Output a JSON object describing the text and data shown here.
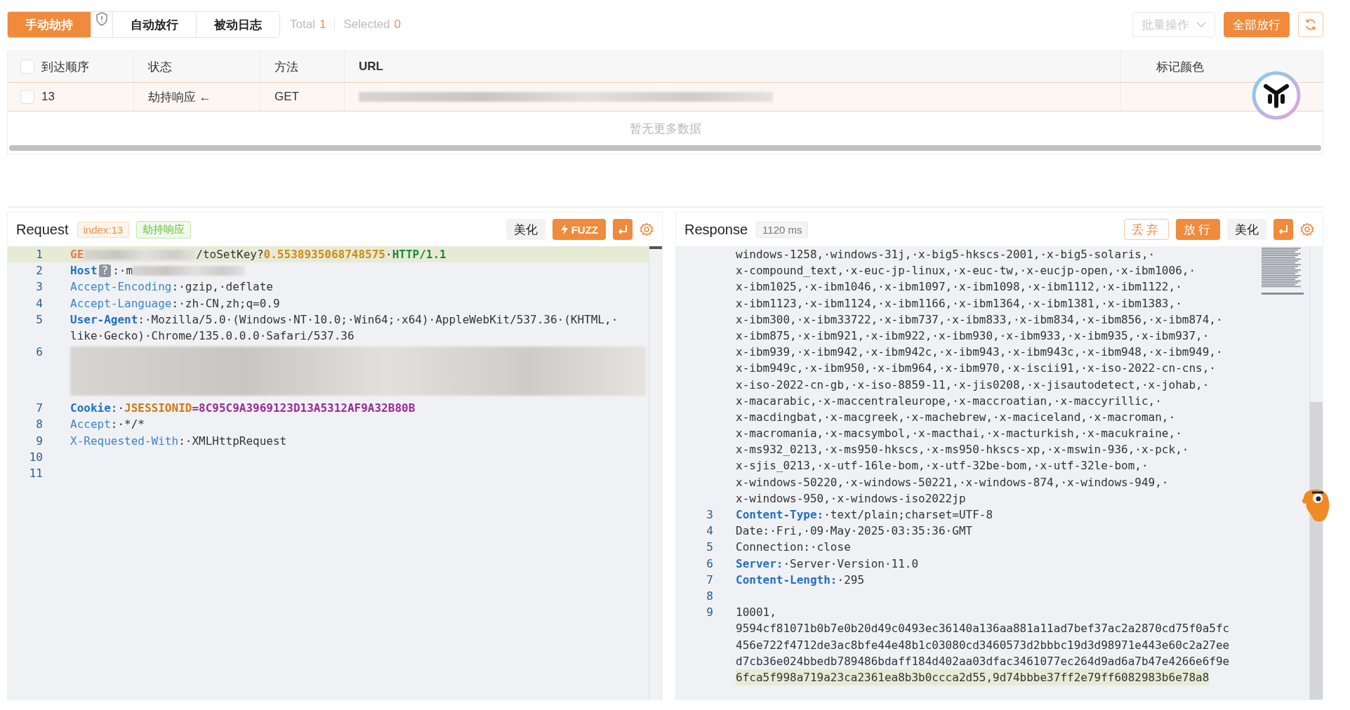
{
  "toolbar": {
    "tabs": [
      {
        "label": "手动劫持",
        "selected": true
      },
      {
        "label": "自动放行",
        "selected": false
      },
      {
        "label": "被动日志",
        "selected": false
      }
    ],
    "stats": [
      {
        "label": "Total",
        "value": "1"
      },
      {
        "label": "Selected",
        "value": "0"
      }
    ],
    "actions": [
      {
        "kind": "dropdown",
        "label": "批量操作",
        "disabled": true
      },
      {
        "kind": "primary",
        "label": "全部放行",
        "disabled": false
      }
    ]
  },
  "table": {
    "all_checked": false,
    "columns": [
      {
        "label": "到达顺序"
      },
      {
        "label": "状态"
      },
      {
        "label": "方法"
      },
      {
        "label": "URL"
      },
      {
        "label": "标记颜色"
      }
    ],
    "rows": [
      {
        "selected": true,
        "checked": false,
        "order": "13",
        "status": "劫持响应",
        "status_icon": "←",
        "method": "GET",
        "url_redacted": true
      }
    ],
    "empty_text": "暂无更多数据"
  },
  "request": {
    "title": "Request",
    "tags": [
      {
        "kind": "warning",
        "text": "index:13"
      },
      {
        "kind": "success",
        "text": "劫持响应"
      }
    ],
    "buttons": [
      {
        "kind": "plain",
        "label": "美化"
      },
      {
        "kind": "fuzz",
        "label": "FUZZ"
      }
    ],
    "lines": [
      {
        "number": "1",
        "highlighted": true,
        "segments": [
          {
            "kind": "method",
            "text": "GE"
          },
          {
            "kind": "redacted"
          },
          {
            "kind": "plain",
            "text": "/toSetKey?"
          },
          {
            "kind": "number",
            "text": "0.5538935068748575"
          },
          {
            "kind": "plain",
            "text": "·"
          },
          {
            "kind": "version",
            "text": "HTTP/1.1"
          }
        ]
      },
      {
        "number": "2",
        "highlighted": false,
        "segments": [
          {
            "kind": "keybold",
            "text": "Host"
          },
          {
            "kind": "hint",
            "text": "?"
          },
          {
            "kind": "plain",
            "text": ":·m"
          },
          {
            "kind": "redacted"
          }
        ]
      },
      {
        "number": "3",
        "highlighted": false,
        "segments": [
          {
            "kind": "key",
            "text": "Accept-Encoding"
          },
          {
            "kind": "plain",
            "text": ":·gzip,·deflate"
          }
        ]
      },
      {
        "number": "4",
        "highlighted": false,
        "segments": [
          {
            "kind": "key",
            "text": "Accept-Language"
          },
          {
            "kind": "plain",
            "text": ":·zh-CN,zh;q=0.9"
          }
        ]
      },
      {
        "number": "5",
        "highlighted": false,
        "segments": [
          {
            "kind": "keybold",
            "text": "User-Agent"
          },
          {
            "kind": "plain",
            "text": ":·Mozilla/5.0·(Windows·NT·10.0;·Win64;·x64)·AppleWebKit/537.36·(KHTML,·"
          }
        ]
      },
      {
        "highlighted": false,
        "segments": [
          {
            "kind": "plain",
            "text": "like·Gecko)·Chrome/135.0.0.0·Safari/537.36"
          }
        ]
      },
      {
        "number": "6",
        "highlighted": false,
        "segments": [
          {
            "kind": "redacted-block"
          }
        ]
      },
      {
        "number": "7",
        "highlighted": false,
        "segments": [
          {
            "kind": "keybold",
            "text": "Cookie"
          },
          {
            "kind": "plain",
            "text": ":·"
          },
          {
            "kind": "cookie-name",
            "text": "JSESSIONID"
          },
          {
            "kind": "cookie-value",
            "text": "=8C95C9A3969123D13A5312AF9A32B80B"
          }
        ]
      },
      {
        "number": "8",
        "highlighted": false,
        "segments": [
          {
            "kind": "key",
            "text": "Accept"
          },
          {
            "kind": "plain",
            "text": ":·*/*"
          }
        ]
      },
      {
        "number": "9",
        "highlighted": false,
        "segments": [
          {
            "kind": "key",
            "text": "X-Requested-With"
          },
          {
            "kind": "plain",
            "text": ":·XMLHttpRequest"
          }
        ]
      },
      {
        "number": "10",
        "highlighted": false
      },
      {
        "number": "11",
        "highlighted": false
      }
    ]
  },
  "response": {
    "title": "Response",
    "tags": [
      {
        "kind": "info",
        "text": "1120 ms"
      }
    ],
    "buttons": [
      {
        "kind": "outline",
        "label": "丢弃"
      },
      {
        "kind": "primary",
        "label": "放行"
      },
      {
        "kind": "plain",
        "label": "美化"
      }
    ],
    "lines": [
      {
        "highlighted": false,
        "segments": [
          {
            "kind": "plain",
            "text": "windows-1258,·windows-31j,·x-big5-hkscs-2001,·x-big5-solaris,·"
          }
        ]
      },
      {
        "highlighted": false,
        "segments": [
          {
            "kind": "plain",
            "text": "x-compound_text,·x-euc-jp-linux,·x-euc-tw,·x-eucjp-open,·x-ibm1006,·"
          }
        ]
      },
      {
        "highlighted": false,
        "segments": [
          {
            "kind": "plain",
            "text": "x-ibm1025,·x-ibm1046,·x-ibm1097,·x-ibm1098,·x-ibm1112,·x-ibm1122,·"
          }
        ]
      },
      {
        "highlighted": false,
        "segments": [
          {
            "kind": "plain",
            "text": "x-ibm1123,·x-ibm1124,·x-ibm1166,·x-ibm1364,·x-ibm1381,·x-ibm1383,·"
          }
        ]
      },
      {
        "highlighted": false,
        "segments": [
          {
            "kind": "plain",
            "text": "x-ibm300,·x-ibm33722,·x-ibm737,·x-ibm833,·x-ibm834,·x-ibm856,·x-ibm874,·"
          }
        ]
      },
      {
        "highlighted": false,
        "segments": [
          {
            "kind": "plain",
            "text": "x-ibm875,·x-ibm921,·x-ibm922,·x-ibm930,·x-ibm933,·x-ibm935,·x-ibm937,·"
          }
        ]
      },
      {
        "highlighted": false,
        "segments": [
          {
            "kind": "plain",
            "text": "x-ibm939,·x-ibm942,·x-ibm942c,·x-ibm943,·x-ibm943c,·x-ibm948,·x-ibm949,·"
          }
        ]
      },
      {
        "highlighted": false,
        "segments": [
          {
            "kind": "plain",
            "text": "x-ibm949c,·x-ibm950,·x-ibm964,·x-ibm970,·x-iscii91,·x-iso-2022-cn-cns,·"
          }
        ]
      },
      {
        "highlighted": false,
        "segments": [
          {
            "kind": "plain",
            "text": "x-iso-2022-cn-gb,·x-iso-8859-11,·x-jis0208,·x-jisautodetect,·x-johab,·"
          }
        ]
      },
      {
        "highlighted": false,
        "segments": [
          {
            "kind": "plain",
            "text": "x-macarabic,·x-maccentraleurope,·x-maccroatian,·x-maccyrillic,·"
          }
        ]
      },
      {
        "highlighted": false,
        "segments": [
          {
            "kind": "plain",
            "text": "x-macdingbat,·x-macgreek,·x-machebrew,·x-maciceland,·x-macroman,·"
          }
        ]
      },
      {
        "highlighted": false,
        "segments": [
          {
            "kind": "plain",
            "text": "x-macromania,·x-macsymbol,·x-macthai,·x-macturkish,·x-macukraine,·"
          }
        ]
      },
      {
        "highlighted": false,
        "segments": [
          {
            "kind": "plain",
            "text": "x-ms932_0213,·x-ms950-hkscs,·x-ms950-hkscs-xp,·x-mswin-936,·x-pck,·"
          }
        ]
      },
      {
        "highlighted": false,
        "segments": [
          {
            "kind": "plain",
            "text": "x-sjis_0213,·x-utf-16le-bom,·x-utf-32be-bom,·x-utf-32le-bom,·"
          }
        ]
      },
      {
        "highlighted": false,
        "segments": [
          {
            "kind": "plain",
            "text": "x-windows-50220,·x-windows-50221,·x-windows-874,·x-windows-949,·"
          }
        ]
      },
      {
        "highlighted": false,
        "segments": [
          {
            "kind": "plain",
            "text": "x-windows-950,·x-windows-iso2022jp"
          }
        ]
      },
      {
        "number": "3",
        "highlighted": false,
        "segments": [
          {
            "kind": "keybold",
            "text": "Content-Type:"
          },
          {
            "kind": "plain",
            "text": "·text/plain;charset=UTF-8"
          }
        ]
      },
      {
        "number": "4",
        "highlighted": false,
        "segments": [
          {
            "kind": "plain",
            "text": "Date:·Fri,·09·May·2025·03:35:36·GMT"
          }
        ]
      },
      {
        "number": "5",
        "highlighted": false,
        "segments": [
          {
            "kind": "plain",
            "text": "Connection:·close"
          }
        ]
      },
      {
        "number": "6",
        "highlighted": false,
        "segments": [
          {
            "kind": "keybold",
            "text": "Server:"
          },
          {
            "kind": "plain",
            "text": "·Server·Version·11.0"
          }
        ]
      },
      {
        "number": "7",
        "highlighted": false,
        "segments": [
          {
            "kind": "keybold",
            "text": "Content-Length:"
          },
          {
            "kind": "plain",
            "text": "·295"
          }
        ]
      },
      {
        "number": "8",
        "highlighted": false
      },
      {
        "number": "9",
        "highlighted": false,
        "segments": [
          {
            "kind": "plain",
            "text": "10001,"
          }
        ]
      },
      {
        "highlighted": false,
        "segments": [
          {
            "kind": "plain",
            "text": "9594cf81071b0b7e0b20d49c0493ec36140a136aa881a11ad7bef37ac2a2870cd75f0a5fc"
          }
        ]
      },
      {
        "highlighted": false,
        "segments": [
          {
            "kind": "plain",
            "text": "456e722f4712de3ac8bfe44e48b1c03080cd3460573d2bbbc19d3d98971e443e60c2a27ee"
          }
        ]
      },
      {
        "highlighted": false,
        "segments": [
          {
            "kind": "plain",
            "text": "d7cb36e024bbedb789486bdaff184d402aa03dfac3461077ec264d9ad6a7b47e4266e6f9e"
          }
        ]
      },
      {
        "highlighted": true,
        "segments": [
          {
            "kind": "plain",
            "text": "6fca5f998a719a23ca2361ea8b3b0ccca2d55,9d74bbbe37ff2e79ff6082983b6e78a8"
          }
        ]
      }
    ]
  }
}
